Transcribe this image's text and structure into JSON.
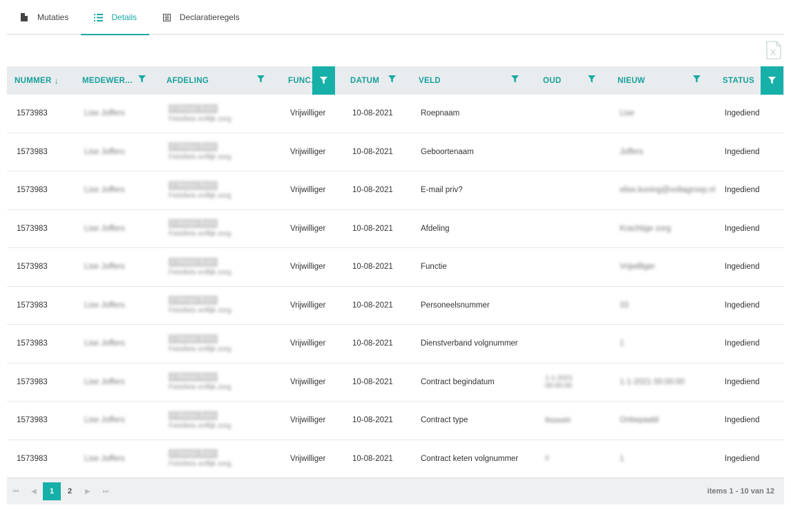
{
  "tabs": [
    {
      "label": "Mutaties",
      "icon": "document-icon",
      "active": false
    },
    {
      "label": "Details",
      "icon": "list-icon",
      "active": true
    },
    {
      "label": "Declaratieregels",
      "icon": "form-icon",
      "active": false
    }
  ],
  "colors": {
    "accent": "#17a9a3",
    "header_bg": "#e9ecef",
    "pager_bg": "#eef0f2"
  },
  "grid": {
    "columns": [
      {
        "label": "NUMMER",
        "sort": "↓",
        "filter": "none"
      },
      {
        "label": "MEDEWER...",
        "filter": "inactive"
      },
      {
        "label": "AFDELING",
        "filter": "inactive"
      },
      {
        "label": "FUNC...",
        "filter": "active"
      },
      {
        "label": "DATUM",
        "filter": "inactive"
      },
      {
        "label": "VELD",
        "filter": "inactive"
      },
      {
        "label": "OUD",
        "filter": "inactive"
      },
      {
        "label": "NIEUW",
        "filter": "inactive"
      },
      {
        "label": "STATUS",
        "filter": "active"
      }
    ],
    "rows": [
      {
        "nummer": "1573983",
        "medewerker": "Lise Joffers",
        "afdeling1": "4 Weeps Bonn",
        "afdeling2": "Fietsfiets enflijk zorg",
        "functie": "Vrijwilliger",
        "datum": "10-08-2021",
        "veld": "Roepnaam",
        "oud": "",
        "oud2": "",
        "nieuw": "Lise",
        "status": "Ingediend"
      },
      {
        "nummer": "1573983",
        "medewerker": "Lise Joffers",
        "afdeling1": "4 Weeps Bonn",
        "afdeling2": "Fietsfiets enflijk zorg",
        "functie": "Vrijwilliger",
        "datum": "10-08-2021",
        "veld": "Geboortenaam",
        "oud": "",
        "oud2": "",
        "nieuw": "Joffers",
        "status": "Ingediend"
      },
      {
        "nummer": "1573983",
        "medewerker": "Lise Joffers",
        "afdeling1": "4 Weeps Bonn",
        "afdeling2": "Fietsfiets enflijk zorg",
        "functie": "Vrijwilliger",
        "datum": "10-08-2021",
        "veld": "E-mail priv?",
        "oud": "",
        "oud2": "",
        "nieuw": "elise.koning@voltagroep.nl",
        "status": "Ingediend"
      },
      {
        "nummer": "1573983",
        "medewerker": "Lise Joffers",
        "afdeling1": "4 Weeps Bonn",
        "afdeling2": "Fietsfiets enflijk zorg",
        "functie": "Vrijwilliger",
        "datum": "10-08-2021",
        "veld": "Afdeling",
        "oud": "",
        "oud2": "",
        "nieuw": "Krachtige zorg",
        "status": "Ingediend"
      },
      {
        "nummer": "1573983",
        "medewerker": "Lise Joffers",
        "afdeling1": "4 Weeps Bonn",
        "afdeling2": "Fietsfiets enflijk zorg",
        "functie": "Vrijwilliger",
        "datum": "10-08-2021",
        "veld": "Functie",
        "oud": "",
        "oud2": "",
        "nieuw": "Vrijwilliger",
        "status": "Ingediend"
      },
      {
        "nummer": "1573983",
        "medewerker": "Lise Joffers",
        "afdeling1": "4 Weeps Bonn",
        "afdeling2": "Fietsfiets enflijk zorg",
        "functie": "Vrijwilliger",
        "datum": "10-08-2021",
        "veld": "Personeelsnummer",
        "oud": "",
        "oud2": "",
        "nieuw": "33",
        "status": "Ingediend"
      },
      {
        "nummer": "1573983",
        "medewerker": "Lise Joffers",
        "afdeling1": "4 Weeps Bonn",
        "afdeling2": "Fietsfiets enflijk zorg",
        "functie": "Vrijwilliger",
        "datum": "10-08-2021",
        "veld": "Dienstverband volgnummer",
        "oud": "",
        "oud2": "",
        "nieuw": "1",
        "status": "Ingediend"
      },
      {
        "nummer": "1573983",
        "medewerker": "Lise Joffers",
        "afdeling1": "4 Weeps Bonn",
        "afdeling2": "Fietsfiets enflijk zorg",
        "functie": "Vrijwilliger",
        "datum": "10-08-2021",
        "veld": "Contract begindatum",
        "oud": "1-1-2021",
        "oud2": "00:00:00",
        "nieuw": "1-1-2021 00:00:00",
        "status": "Ingediend"
      },
      {
        "nummer": "1573983",
        "medewerker": "Lise Joffers",
        "afdeling1": "4 Weeps Bonn",
        "afdeling2": "Fietsfiets enflijk zorg",
        "functie": "Vrijwilliger",
        "datum": "10-08-2021",
        "veld": "Contract type",
        "oud": "Bepaald",
        "oud2": "",
        "nieuw": "Onbepaald",
        "status": "Ingediend"
      },
      {
        "nummer": "1573983",
        "medewerker": "Lise Joffers",
        "afdeling1": "4 Weeps Bonn",
        "afdeling2": "Fietsfiets enflijk zorg",
        "functie": "Vrijwilliger",
        "datum": "10-08-2021",
        "veld": "Contract keten volgnummer",
        "oud": "0",
        "oud2": "",
        "nieuw": "1",
        "status": "Ingediend"
      }
    ]
  },
  "pager": {
    "pages": [
      "1",
      "2"
    ],
    "current": "1",
    "info": "items 1 - 10 van 12"
  }
}
